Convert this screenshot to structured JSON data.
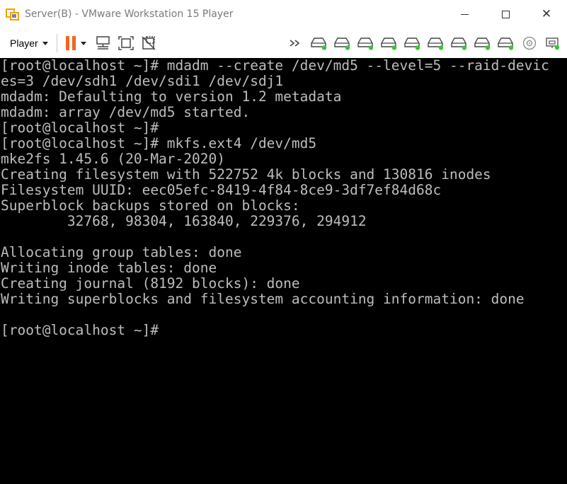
{
  "window": {
    "title": "Server(B) - VMware Workstation 15 Player"
  },
  "toolbar": {
    "player_menu_label": "Player"
  },
  "console": {
    "lines": [
      "[root@localhost ~]# mdadm --create /dev/md5 --level=5 --raid-devic",
      "es=3 /dev/sdh1 /dev/sdi1 /dev/sdj1",
      "mdadm: Defaulting to version 1.2 metadata",
      "mdadm: array /dev/md5 started.",
      "[root@localhost ~]#",
      "[root@localhost ~]# mkfs.ext4 /dev/md5",
      "mke2fs 1.45.6 (20-Mar-2020)",
      "Creating filesystem with 522752 4k blocks and 130816 inodes",
      "Filesystem UUID: eec05efc-8419-4f84-8ce9-3df7ef84d68c",
      "Superblock backups stored on blocks:",
      "        32768, 98304, 163840, 229376, 294912",
      "",
      "Allocating group tables: done",
      "Writing inode tables: done",
      "Creating journal (8192 blocks): done",
      "Writing superblocks and filesystem accounting information: done",
      "",
      "[root@localhost ~]#"
    ]
  },
  "colors": {
    "pause_accent": "#f26522",
    "device_active_dot": "#3cc23c",
    "app_icon": "#f0a000",
    "console_text": "#bdbdbd",
    "console_bg": "#000000"
  },
  "icons": {
    "toolbar_left": [
      "send-ctrl-alt-del-icon",
      "fit-guest-icon",
      "unity-icon"
    ],
    "toolbar_right": [
      "more-devices-icon",
      "hard-disk-1-icon",
      "hard-disk-2-icon",
      "hard-disk-3-icon",
      "hard-disk-4-icon",
      "hard-disk-5-icon",
      "hard-disk-6-icon",
      "hard-disk-7-icon",
      "hard-disk-8-icon",
      "hard-disk-9-icon",
      "cd-dvd-icon",
      "network-adapter-icon"
    ]
  }
}
